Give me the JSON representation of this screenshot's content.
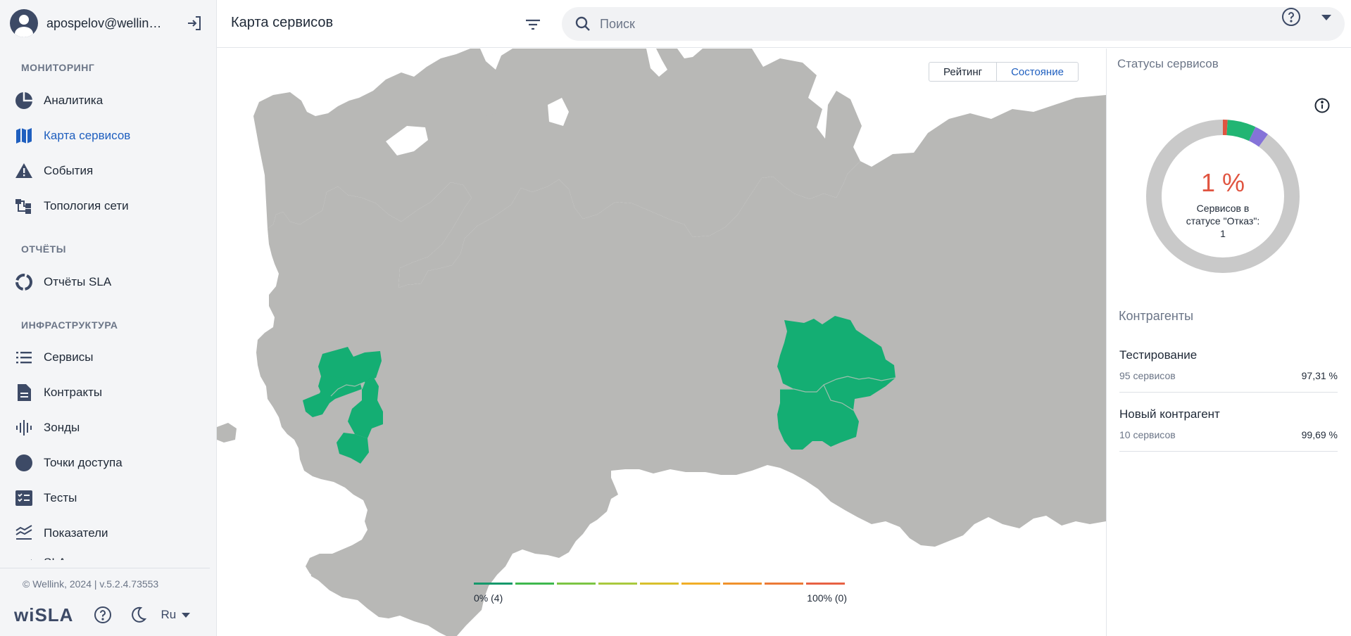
{
  "user": {
    "name": "apospelov@wellink.ru"
  },
  "sidebar": {
    "sections": [
      {
        "title": "МОНИТОРИНГ"
      },
      {
        "title": "ОТЧЁТЫ"
      },
      {
        "title": "ИНФРАСТРУКТУРА"
      }
    ],
    "items": [
      {
        "label": "Аналитика",
        "icon": "pie-chart-icon"
      },
      {
        "label": "Карта сервисов",
        "icon": "map-icon",
        "active": true
      },
      {
        "label": "События",
        "icon": "warning-icon"
      },
      {
        "label": "Топология сети",
        "icon": "topology-icon"
      },
      {
        "label": "Отчёты SLA",
        "icon": "donut-report-icon"
      },
      {
        "label": "Сервисы",
        "icon": "list-icon"
      },
      {
        "label": "Контракты",
        "icon": "document-icon"
      },
      {
        "label": "Зонды",
        "icon": "signal-icon"
      },
      {
        "label": "Точки доступа",
        "icon": "dot-icon"
      },
      {
        "label": "Тесты",
        "icon": "checklist-icon"
      },
      {
        "label": "Показатели",
        "icon": "metrics-icon"
      },
      {
        "label": "SLA",
        "icon": "sla-icon"
      }
    ],
    "copyright": "© Wellink, 2024 | v.5.2.4.73553",
    "logo": "wiSLA",
    "language": "Ru"
  },
  "header": {
    "title": "Карта сервисов",
    "search_placeholder": "Поиск"
  },
  "map": {
    "toggle": {
      "rating": "Рейтинг",
      "state": "Состояние",
      "selected": "state"
    },
    "legend": {
      "min_label": "0% (4)",
      "max_label": "100% (0)",
      "colors": [
        "#15996b",
        "#3fb84e",
        "#7cc544",
        "#a9c93e",
        "#d8c02c",
        "#f1ae27",
        "#f0922c",
        "#ec7a36",
        "#e76143"
      ]
    },
    "land_color": "#b8b8b6",
    "region_color": "#14ae73"
  },
  "panel": {
    "title": "Статусы сервисов",
    "donut": {
      "value": "1 %",
      "caption": "Сервисов в статусе \"Отказ\": 1",
      "segments": [
        {
          "status": "failure",
          "color": "#e05440",
          "share": 0.01
        },
        {
          "status": "ok",
          "color": "#22b573",
          "share": 0.06
        },
        {
          "status": "warning",
          "color": "#8573d8",
          "share": 0.03
        },
        {
          "status": "unknown",
          "color": "#c9c9c9",
          "share": 0.9
        }
      ]
    },
    "counterparties_title": "Контрагенты",
    "counterparties": [
      {
        "name": "Тестирование",
        "services": "95 сервисов",
        "percent": "97,31 %"
      },
      {
        "name": "Новый контрагент",
        "services": "10 сервисов",
        "percent": "99,69 %"
      }
    ]
  }
}
